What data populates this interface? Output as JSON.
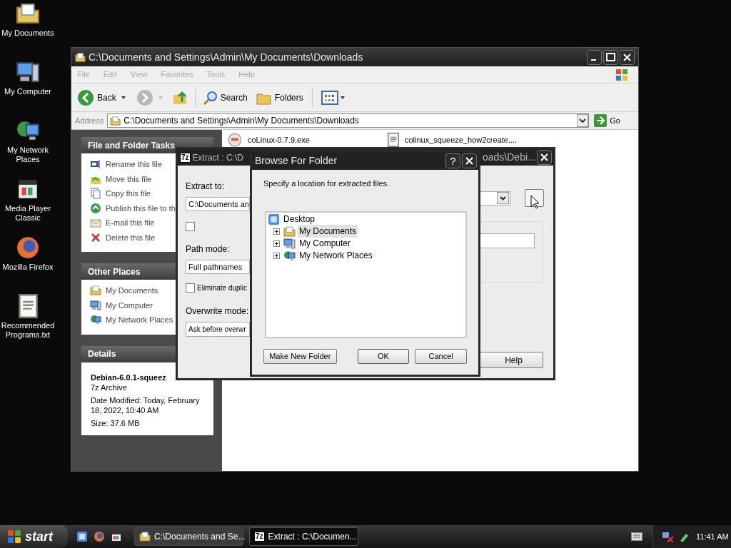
{
  "desktop_icons": [
    {
      "label": "My Documents",
      "kind": "documents"
    },
    {
      "label": "My Computer",
      "kind": "computer"
    },
    {
      "label": "My Network Places",
      "kind": "network"
    },
    {
      "label": "Media Player Classic",
      "kind": "media"
    },
    {
      "label": "Mozilla Firefox",
      "kind": "firefox"
    },
    {
      "label": "Recommended Programs.txt",
      "kind": "text"
    }
  ],
  "explorer": {
    "title": "C:\\Documents and Settings\\Admin\\My Documents\\Downloads",
    "menu": [
      "File",
      "Edit",
      "View",
      "Favorites",
      "Tools",
      "Help"
    ],
    "toolbar": {
      "back": "Back",
      "search": "Search",
      "folders": "Folders"
    },
    "address": {
      "label": "Address",
      "value": "C:\\Documents and Settings\\Admin\\My Documents\\Downloads",
      "go": "Go"
    },
    "task_panes": [
      {
        "title": "File and Folder Tasks",
        "items": [
          {
            "label": "Rename this file",
            "kind": "rename"
          },
          {
            "label": "Move this file",
            "kind": "move"
          },
          {
            "label": "Copy this file",
            "kind": "copy"
          },
          {
            "label": "Publish this file to th",
            "kind": "publish"
          },
          {
            "label": "E-mail this file",
            "kind": "email"
          },
          {
            "label": "Delete this file",
            "kind": "delete"
          }
        ]
      },
      {
        "title": "Other Places",
        "items": [
          {
            "label": "My Documents",
            "kind": "documents"
          },
          {
            "label": "My Computer",
            "kind": "computer"
          },
          {
            "label": "My Network Places",
            "kind": "network"
          }
        ]
      }
    ],
    "details": {
      "title": "Details",
      "name": "Debian-6.0.1-squeez",
      "type": "7z Archive",
      "modified": "Date Modified: Today, February 18, 2022, 10:40 AM",
      "size": "Size: 37.6 MB"
    },
    "files": [
      {
        "name": "coLinux-0.7.9.exe",
        "kind": "exe"
      },
      {
        "name": "colinux_squeeze_how2create....",
        "kind": "text"
      }
    ]
  },
  "extract_dialog": {
    "badge": "7z",
    "title_start": "Extract : C:\\D",
    "title_end": "oads\\Debi...",
    "extract_to_label": "Extract to:",
    "extract_to_value": "C:\\Documents an",
    "option_checked": false,
    "path_mode_label": "Path mode:",
    "path_mode_value": "Full pathnames",
    "eliminate": {
      "label": "Eliminate duplic",
      "checked": false
    },
    "overwrite_label": "Overwrite mode:",
    "overwrite_value": "Ask before overwr",
    "help": "Help"
  },
  "browse_dialog": {
    "title": "Browse For Folder",
    "help_glyph": "?",
    "prompt": "Specify a location for extracted files.",
    "tree": [
      {
        "label": "Desktop",
        "kind": "desktop",
        "selected": false,
        "children": [
          {
            "label": "My Documents",
            "kind": "documents",
            "selected": true,
            "expanded": false
          },
          {
            "label": "My Computer",
            "kind": "computer",
            "selected": false,
            "expanded": false
          },
          {
            "label": "My Network Places",
            "kind": "network",
            "selected": false,
            "expanded": false
          }
        ]
      }
    ],
    "buttons": {
      "new_folder": "Make New Folder",
      "ok": "OK",
      "cancel": "Cancel"
    }
  },
  "taskbar": {
    "start": "start",
    "tasks": [
      {
        "label": "C:\\Documents and Se...",
        "kind": "folder",
        "selected": false
      },
      {
        "label": "Extract : C:\\Documen...",
        "kind": "archive",
        "badge": "7z",
        "selected": true
      }
    ],
    "time": "11:41 AM"
  }
}
